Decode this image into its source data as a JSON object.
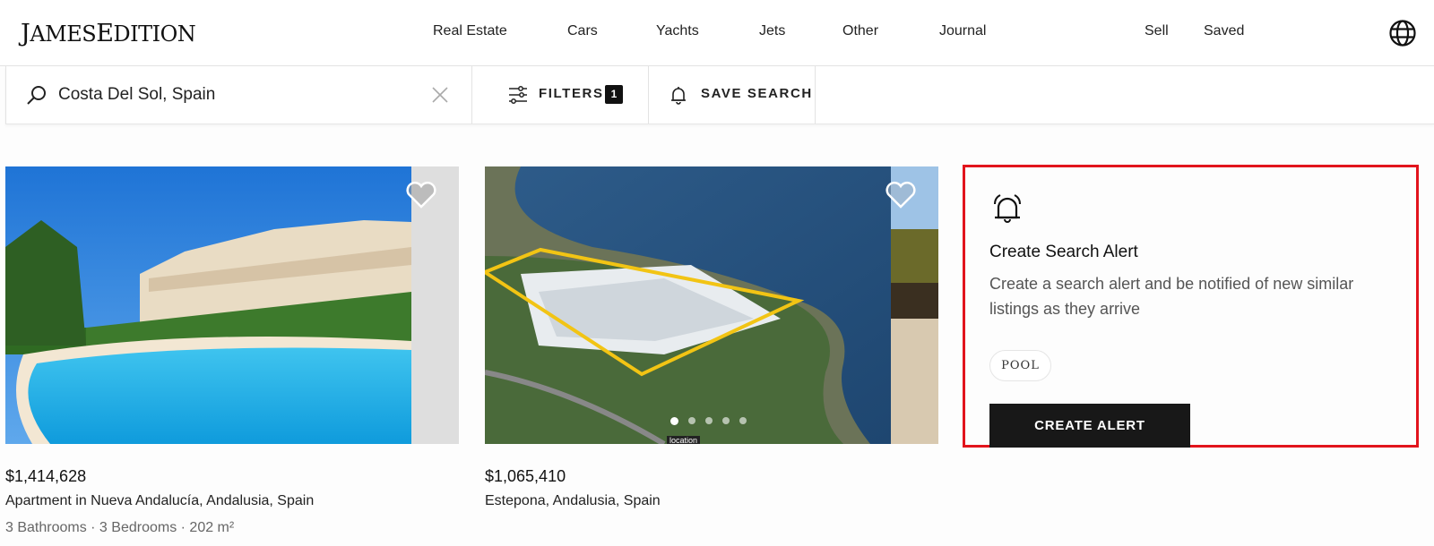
{
  "header": {
    "logo_first": "J",
    "logo_rest1": "AMES",
    "logo_mid": "E",
    "logo_rest2": "DITION",
    "nav": [
      "Real Estate",
      "Cars",
      "Yachts",
      "Jets",
      "Other",
      "Journal"
    ],
    "right_nav": [
      "Sell",
      "Saved"
    ]
  },
  "search": {
    "value": "Costa Del Sol, Spain",
    "filters_label": "FILTERS",
    "filters_count": "1",
    "save_label": "SAVE SEARCH"
  },
  "listings": [
    {
      "price": "$1,414,628",
      "location": "Apartment in Nueva Andalucía, Andalusia, Spain",
      "specs": "3 Bathrooms · 3 Bedrooms · 202 m²"
    },
    {
      "price": "$1,065,410",
      "location": "Estepona, Andalusia, Spain",
      "image_label": "location",
      "carousel_dots": 5,
      "carousel_active": 1
    }
  ],
  "alert_card": {
    "title": "Create Search Alert",
    "description": "Create a search alert and be notified of new similar listings as they arrive",
    "chip": "POOL",
    "button": "CREATE ALERT",
    "highlight_color": "#e2141c"
  }
}
